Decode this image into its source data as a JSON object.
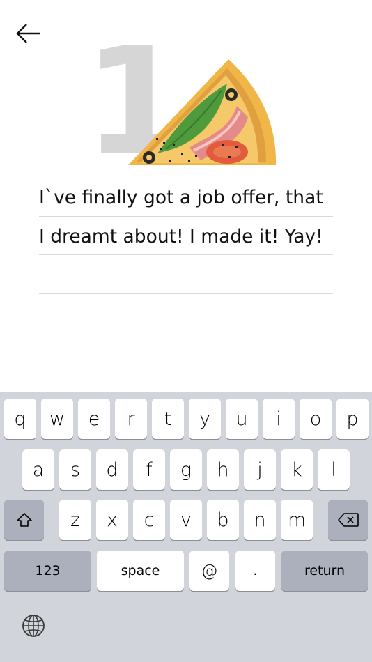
{
  "nav": {
    "back_icon": "arrow-left-icon"
  },
  "hero": {
    "digit": "1",
    "illustration": "pizza-slice-illustration"
  },
  "note": {
    "lines": [
      "I`ve finally got a job offer, that",
      "I dreamt about! I made it! Yay!",
      "",
      ""
    ]
  },
  "keyboard": {
    "row1": [
      "q",
      "w",
      "e",
      "r",
      "t",
      "y",
      "u",
      "i",
      "o",
      "p"
    ],
    "row2": [
      "a",
      "s",
      "d",
      "f",
      "g",
      "h",
      "j",
      "k",
      "l"
    ],
    "row3": [
      "z",
      "x",
      "c",
      "v",
      "b",
      "n",
      "m"
    ],
    "shift_icon": "shift-icon",
    "delete_icon": "backspace-icon",
    "numbers_label": "123",
    "space_label": "space",
    "at_label": "@",
    "dot_label": ".",
    "return_label": "return",
    "globe_icon": "globe-icon"
  },
  "colors": {
    "keyboard_bg": "#d1d4db",
    "key_bg": "#ffffff",
    "fn_key_bg": "#abb0bc",
    "digit": "#d6d6d6",
    "rule": "#d9d9d9"
  }
}
